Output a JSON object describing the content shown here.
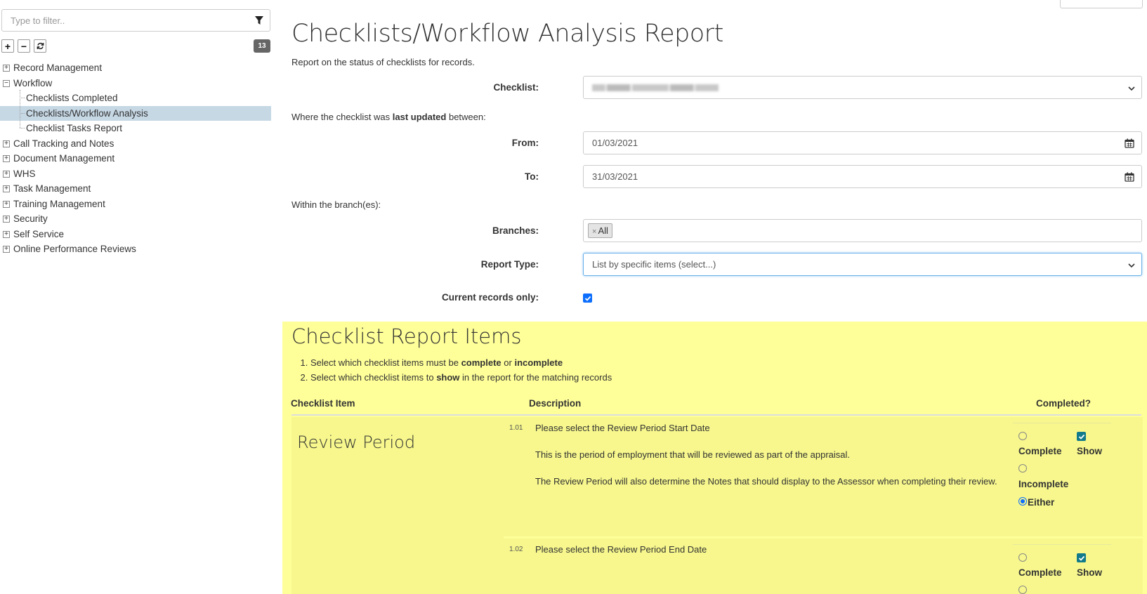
{
  "sidebar": {
    "filter_placeholder": "Type to filter..",
    "expand_all": "+",
    "collapse_all": "−",
    "count": "13",
    "tree": [
      {
        "label": "Record Management",
        "expanded": false
      },
      {
        "label": "Workflow",
        "expanded": true
      },
      {
        "label": "Checklists Completed",
        "child": true
      },
      {
        "label": "Checklists/Workflow Analysis",
        "child": true,
        "selected": true
      },
      {
        "label": "Checklist Tasks Report",
        "child": true
      },
      {
        "label": "Call Tracking and Notes",
        "expanded": false
      },
      {
        "label": "Document Management",
        "expanded": false
      },
      {
        "label": "WHS",
        "expanded": false
      },
      {
        "label": "Task Management",
        "expanded": false
      },
      {
        "label": "Training Management",
        "expanded": false
      },
      {
        "label": "Security",
        "expanded": false
      },
      {
        "label": "Self Service",
        "expanded": false
      },
      {
        "label": "Online Performance Reviews",
        "expanded": false
      }
    ]
  },
  "main": {
    "title": "Checklists/Workflow Analysis Report",
    "subtitle": "Report on the status of checklists for records.",
    "checklist_label": "Checklist:",
    "last_updated_pre": "Where the checklist was ",
    "last_updated_bold": "last updated",
    "last_updated_post": " between:",
    "from_label": "From:",
    "from_value": "01/03/2021",
    "to_label": "To:",
    "to_value": "31/03/2021",
    "branches_intro": "Within the branch(es):",
    "branches_label": "Branches:",
    "branch_tag": "All",
    "report_type_label": "Report Type:",
    "report_type_value": "List by specific items (select...)",
    "current_label": "Current records only:",
    "current_checked": true
  },
  "report": {
    "title": "Checklist Report Items",
    "step1_pre": "Select which checklist items must be ",
    "step1_b1": "complete",
    "step1_mid": " or ",
    "step1_b2": "incomplete",
    "step2_pre": "Select which checklist items to ",
    "step2_b": "show",
    "step2_post": " in the report for the matching records",
    "headers": {
      "item": "Checklist Item",
      "description": "Description",
      "completed": "Completed?"
    },
    "group": "Review Period",
    "options": {
      "complete": "Complete",
      "incomplete": "Incomplete",
      "either": "Either",
      "show": "Show"
    },
    "items": [
      {
        "num": "1.01",
        "title": "Please select the Review Period Start Date",
        "lines": [
          "This is the period of employment that will be reviewed as part of the appraisal.",
          "The Review Period will also determine the Notes that should display to the Assessor when completing their review."
        ],
        "selected": "either",
        "show": true
      },
      {
        "num": "1.02",
        "title": "Please select the Review Period End Date",
        "lines": [],
        "selected": "either",
        "show": true
      }
    ]
  },
  "colors": {
    "selected_row": "#c7d8e5",
    "report_bg": "#ffff99",
    "checkbox_blue": "#0d6efd",
    "checkbox_teal": "#127a8a"
  }
}
